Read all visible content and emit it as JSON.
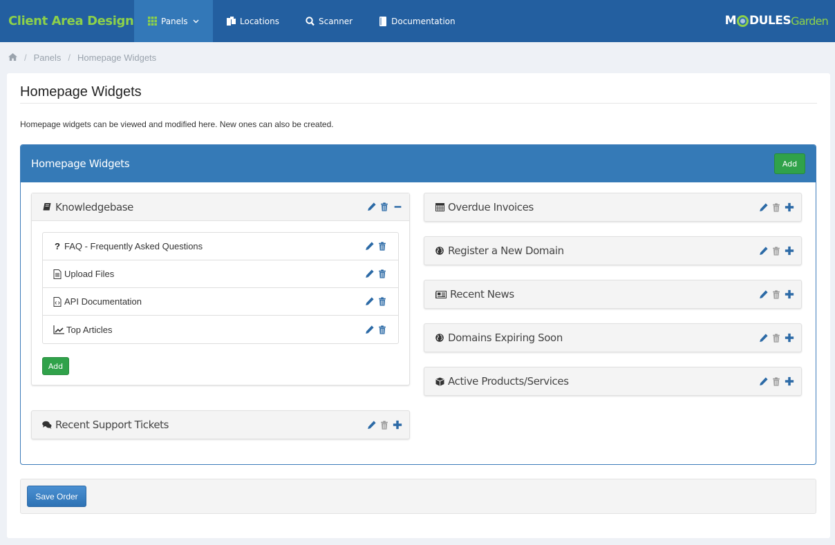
{
  "app": {
    "brand": "Client Area Designer",
    "nav": [
      {
        "label": "Panels",
        "icon": "grid-icon",
        "active": true,
        "has_dropdown": true
      },
      {
        "label": "Locations",
        "icon": "files-icon"
      },
      {
        "label": "Scanner",
        "icon": "search-icon"
      },
      {
        "label": "Documentation",
        "icon": "book-icon"
      }
    ],
    "logo": {
      "part1": "M",
      "part2": "DULES",
      "part3": "Garden"
    }
  },
  "breadcrumb": {
    "home_icon": "home-icon",
    "items": [
      "Panels",
      "Homepage Widgets"
    ]
  },
  "page": {
    "title": "Homepage Widgets",
    "description": "Homepage widgets can be viewed and modified here. New ones can also be created."
  },
  "panel": {
    "title": "Homepage Widgets",
    "add_label": "Add",
    "left_column": [
      {
        "name": "Knowledgebase",
        "icon": "book-icon",
        "expanded": true,
        "items": [
          {
            "label": "FAQ - Frequently Asked Questions",
            "icon": "question-icon"
          },
          {
            "label": "Upload Files",
            "icon": "file-text-icon"
          },
          {
            "label": "API Documentation",
            "icon": "file-code-icon"
          },
          {
            "label": "Top Articles",
            "icon": "line-chart-icon"
          }
        ],
        "add_label": "Add"
      },
      {
        "name": "Recent Support Tickets",
        "icon": "comments-icon",
        "expanded": false
      }
    ],
    "right_column": [
      {
        "name": "Overdue Invoices",
        "icon": "calculator-icon"
      },
      {
        "name": "Register a New Domain",
        "icon": "globe-icon"
      },
      {
        "name": "Recent News",
        "icon": "newspaper-icon"
      },
      {
        "name": "Domains Expiring Soon",
        "icon": "globe-icon"
      },
      {
        "name": "Active Products/Services",
        "icon": "cube-icon"
      }
    ]
  },
  "footer": {
    "save_label": "Save Order"
  },
  "colors": {
    "nav_bg": "#235fa0",
    "nav_active": "#3378b8",
    "brand_green": "#8dd14a",
    "panel_blue": "#357ab7",
    "add_green": "#30a24a",
    "icon_blue": "#2c6aa6",
    "trash_gray": "#999999"
  }
}
